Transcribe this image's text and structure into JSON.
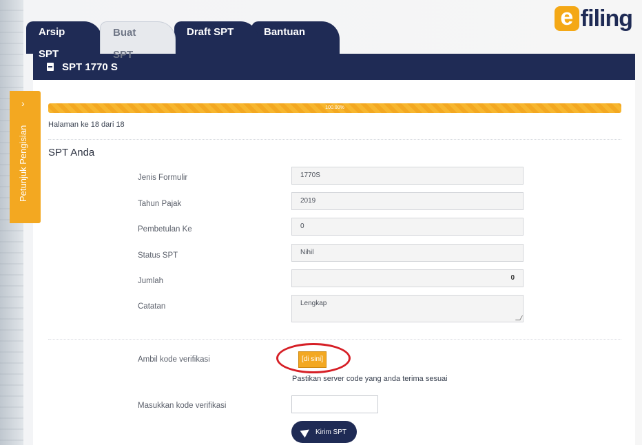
{
  "tabs": [
    {
      "label": "Arsip SPT"
    },
    {
      "label": "Buat SPT"
    },
    {
      "label": "Draft SPT"
    },
    {
      "label": "Bantuan"
    }
  ],
  "logo": {
    "letter": "e",
    "text": "filing"
  },
  "panel": {
    "title": "SPT 1770 S"
  },
  "progress": {
    "percent_label": "100.00%",
    "value": 1.0
  },
  "page_info": "Halaman ke 18 dari 18",
  "section_title": "SPT Anda",
  "fields": {
    "jenis_formulir": {
      "label": "Jenis Formulir",
      "value": "1770S"
    },
    "tahun_pajak": {
      "label": "Tahun Pajak",
      "value": "2019"
    },
    "pembetulan_ke": {
      "label": "Pembetulan Ke",
      "value": "0"
    },
    "status_spt": {
      "label": "Status SPT",
      "value": "Nihil"
    },
    "jumlah": {
      "label": "Jumlah",
      "value": "0"
    },
    "catatan": {
      "label": "Catatan",
      "value": "Lengkap"
    }
  },
  "verification": {
    "label": "Ambil kode verifikasi",
    "button_label": "[di sini]",
    "note": "Pastikan server code yang anda terima sesuai",
    "input_label": "Masukkan kode verifikasi",
    "input_value": ""
  },
  "send_button": {
    "label": "Kirim SPT",
    "icon": "paper-plane-icon"
  },
  "side_tab": {
    "label": "Petunjuk Pengisian",
    "icon": "chevron-right-icon"
  },
  "colors": {
    "navy": "#1f2b55",
    "accent": "#f3a821",
    "highlight_circle": "#d61f26"
  }
}
